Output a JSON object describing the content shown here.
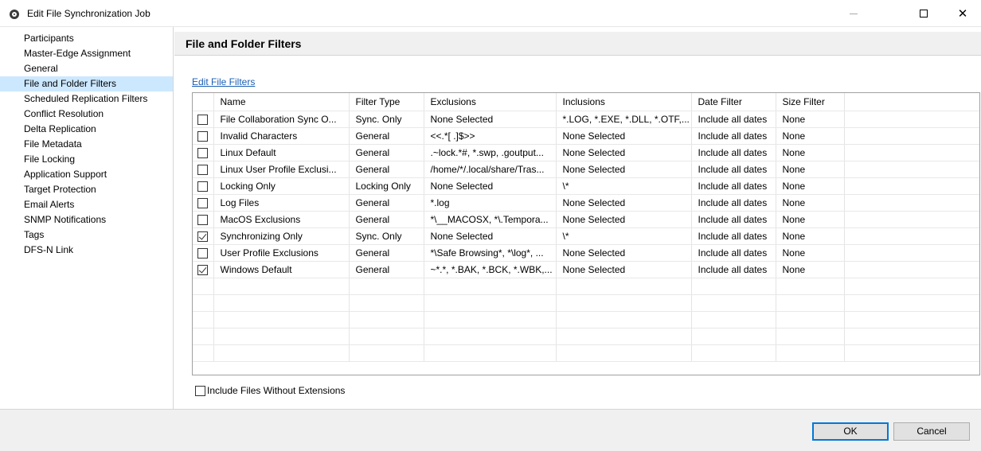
{
  "window": {
    "title": "Edit File Synchronization Job",
    "icon": "app-icon",
    "controls": [
      "minimize-icon",
      "maximize-icon",
      "close-icon"
    ],
    "close_glyph": "✕"
  },
  "sidebar": {
    "items": [
      {
        "label": "Participants"
      },
      {
        "label": "Master-Edge Assignment"
      },
      {
        "label": "General"
      },
      {
        "label": "File and Folder Filters",
        "selected": true
      },
      {
        "label": "Scheduled Replication Filters"
      },
      {
        "label": "Conflict Resolution"
      },
      {
        "label": "Delta Replication"
      },
      {
        "label": "File Metadata"
      },
      {
        "label": "File Locking"
      },
      {
        "label": "Application Support"
      },
      {
        "label": "Target Protection"
      },
      {
        "label": "Email Alerts"
      },
      {
        "label": "SNMP Notifications"
      },
      {
        "label": "Tags"
      },
      {
        "label": "DFS-N Link"
      }
    ]
  },
  "panel": {
    "title": "File and Folder Filters",
    "edit_link": "Edit File Filters"
  },
  "table": {
    "columns": [
      "Name",
      "Filter Type",
      "Exclusions",
      "Inclusions",
      "Date Filter",
      "Size Filter"
    ],
    "rows": [
      {
        "checked": false,
        "name": "File Collaboration Sync O...",
        "type": "Sync. Only",
        "exclusions": "None Selected",
        "inclusions": "*.LOG, *.EXE, *.DLL, *.OTF,...",
        "date": "Include all dates",
        "size": "None"
      },
      {
        "checked": false,
        "name": "Invalid Characters",
        "type": "General",
        "exclusions": "<<.*[ .]$>>",
        "inclusions": "None Selected",
        "date": "Include all dates",
        "size": "None"
      },
      {
        "checked": false,
        "name": "Linux Default",
        "type": "General",
        "exclusions": ".~lock.*#, *.swp, .goutput...",
        "inclusions": "None Selected",
        "date": "Include all dates",
        "size": "None"
      },
      {
        "checked": false,
        "name": "Linux User Profile Exclusi...",
        "type": "General",
        "exclusions": "/home/*/.local/share/Tras...",
        "inclusions": "None Selected",
        "date": "Include all dates",
        "size": "None"
      },
      {
        "checked": false,
        "name": "Locking Only",
        "type": "Locking Only",
        "exclusions": "None Selected",
        "inclusions": "\\*",
        "date": "Include all dates",
        "size": "None"
      },
      {
        "checked": false,
        "name": "Log Files",
        "type": "General",
        "exclusions": "*.log",
        "inclusions": "None Selected",
        "date": "Include all dates",
        "size": "None"
      },
      {
        "checked": false,
        "name": "MacOS Exclusions",
        "type": "General",
        "exclusions": "*\\__MACOSX, *\\.Tempora...",
        "inclusions": "None Selected",
        "date": "Include all dates",
        "size": "None"
      },
      {
        "checked": true,
        "name": "Synchronizing Only",
        "type": "Sync. Only",
        "exclusions": "None Selected",
        "inclusions": "\\*",
        "date": "Include all dates",
        "size": "None"
      },
      {
        "checked": false,
        "name": "User Profile Exclusions",
        "type": "General",
        "exclusions": "*\\Safe Browsing*, *\\log*, ...",
        "inclusions": "None Selected",
        "date": "Include all dates",
        "size": "None"
      },
      {
        "checked": true,
        "name": "Windows Default",
        "type": "General",
        "exclusions": "~*.*, *.BAK, *.BCK, *.WBK,...",
        "inclusions": "None Selected",
        "date": "Include all dates",
        "size": "None"
      }
    ]
  },
  "options": {
    "include_no_ext_label": "Include Files Without Extensions",
    "include_no_ext_checked": false
  },
  "footer": {
    "ok_label": "OK",
    "cancel_label": "Cancel"
  }
}
